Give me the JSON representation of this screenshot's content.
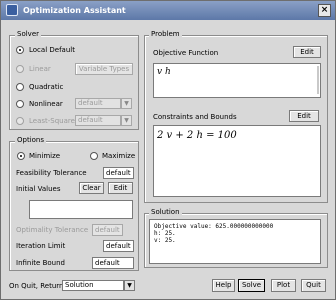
{
  "window": {
    "title": "Optimization Assistant",
    "close_label": "×"
  },
  "solver": {
    "group_label": "Solver",
    "options": [
      {
        "label": "Local Default",
        "selected": true,
        "enabled": true
      },
      {
        "label": "Linear",
        "selected": false,
        "enabled": false
      },
      {
        "label": "Quadratic",
        "selected": false,
        "enabled": true
      },
      {
        "label": "Nonlinear",
        "selected": false,
        "enabled": true
      },
      {
        "label": "Least-Squares",
        "selected": false,
        "enabled": false
      }
    ],
    "variable_types_label": "Variable Types",
    "nonlinear_method": "default",
    "least_squares_method": "default"
  },
  "options": {
    "group_label": "Options",
    "minimize_label": "Minimize",
    "maximize_label": "Maximize",
    "goal": "minimize",
    "feasibility_tolerance_label": "Feasibility Tolerance",
    "feasibility_tolerance_value": "default",
    "initial_values_label": "Initial Values",
    "clear_label": "Clear",
    "edit_label": "Edit",
    "optimality_tolerance_label": "Optimality Tolerance",
    "optimality_tolerance_value": "default",
    "iteration_limit_label": "Iteration Limit",
    "iteration_limit_value": "default",
    "infinite_bound_label": "Infinite Bound",
    "infinite_bound_value": "default"
  },
  "problem": {
    "group_label": "Problem",
    "objective_label": "Objective Function",
    "objective_edit_label": "Edit",
    "objective_value": "v h",
    "constraints_label": "Constraints and Bounds",
    "constraints_edit_label": "Edit",
    "constraints_value": "2 v + 2 h = 100"
  },
  "solution": {
    "group_label": "Solution",
    "lines": [
      "Objective value: 625.000000000000",
      "  h:  25.",
      "  v:  25."
    ]
  },
  "footer": {
    "on_quit_label": "On Quit, Return",
    "on_quit_value": "Solution",
    "help_label": "Help",
    "solve_label": "Solve",
    "plot_label": "Plot",
    "quit_label": "Quit"
  },
  "icons": {
    "title": "maple-leaf-icon",
    "dropdown": "chevron-down-icon"
  },
  "colors": {
    "title_bar": "#5d78a8",
    "dialog_background": "#d8d8d8",
    "disabled_text": "#9a9a9a"
  }
}
